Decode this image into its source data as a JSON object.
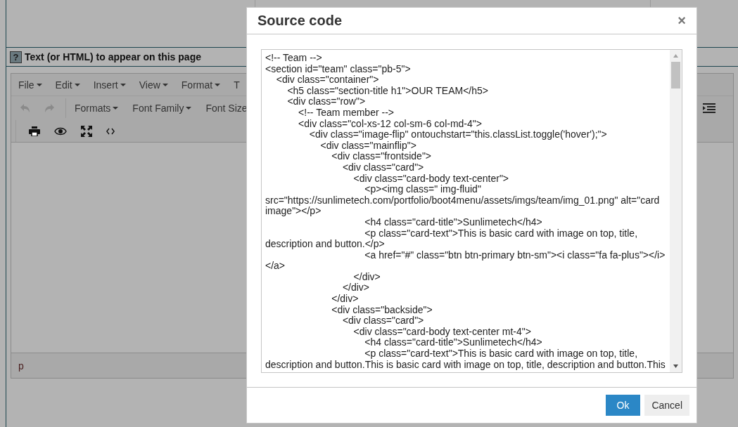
{
  "page": {
    "field_label": "Text (or HTML) to appear on this page",
    "help_icon": "?",
    "menu": [
      {
        "label": "File",
        "caret": true
      },
      {
        "label": "Edit",
        "caret": true
      },
      {
        "label": "Insert",
        "caret": true
      },
      {
        "label": "View",
        "caret": true
      },
      {
        "label": "Format",
        "caret": true
      },
      {
        "label": "T",
        "caret": false
      }
    ],
    "history": [
      {
        "kind": "undo",
        "disabled": true
      },
      {
        "kind": "redo",
        "disabled": true
      }
    ],
    "dropdowns": [
      {
        "label": "Formats",
        "caret": true
      },
      {
        "label": "Font Family",
        "caret": true
      },
      {
        "label": "Font Size",
        "caret": false
      }
    ],
    "tools": [
      {
        "kind": "print"
      },
      {
        "kind": "preview"
      },
      {
        "kind": "fullscreen"
      },
      {
        "kind": "code"
      }
    ],
    "status_path": "p"
  },
  "dialog": {
    "title": "Source code",
    "close": "×",
    "code": "<!-- Team -->\n<section id=\"team\" class=\"pb-5\">\n\t<div class=\"container\">\n\t\t<h5 class=\"section-title h1\">OUR TEAM</h5>\n\t\t<div class=\"row\">\n\t\t\t<!-- Team member -->\n\t\t\t<div class=\"col-xs-12 col-sm-6 col-md-4\">\n\t\t\t\t<div class=\"image-flip\" ontouchstart=\"this.classList.toggle('hover');\">\n\t\t\t\t\t<div class=\"mainflip\">\n\t\t\t\t\t\t<div class=\"frontside\">\n\t\t\t\t\t\t\t<div class=\"card\">\n\t\t\t\t\t\t\t\t<div class=\"card-body text-center\">\n\t\t\t\t\t\t\t\t\t<p><img class=\" img-fluid\" src=\"https://sunlimetech.com/portfolio/boot4menu/assets/imgs/team/img_01.png\" alt=\"card image\"></p>\n\t\t\t\t\t\t\t\t\t<h4 class=\"card-title\">Sunlimetech</h4>\n\t\t\t\t\t\t\t\t\t<p class=\"card-text\">This is basic card with image on top, title, description and button.</p>\n\t\t\t\t\t\t\t\t\t<a href=\"#\" class=\"btn btn-primary btn-sm\"><i class=\"fa fa-plus\"></i></a>\n\t\t\t\t\t\t\t\t</div>\n\t\t\t\t\t\t\t</div>\n\t\t\t\t\t\t</div>\n\t\t\t\t\t\t<div class=\"backside\">\n\t\t\t\t\t\t\t<div class=\"card\">\n\t\t\t\t\t\t\t\t<div class=\"card-body text-center mt-4\">\n\t\t\t\t\t\t\t\t\t<h4 class=\"card-title\">Sunlimetech</h4>\n\t\t\t\t\t\t\t\t\t<p class=\"card-text\">This is basic card with image on top, title, description and button.This is basic card with image on top, title, description and button.This",
    "buttons": [
      {
        "label": "Ok",
        "kind": "primary"
      },
      {
        "label": "Cancel",
        "kind": "secondary"
      }
    ]
  }
}
